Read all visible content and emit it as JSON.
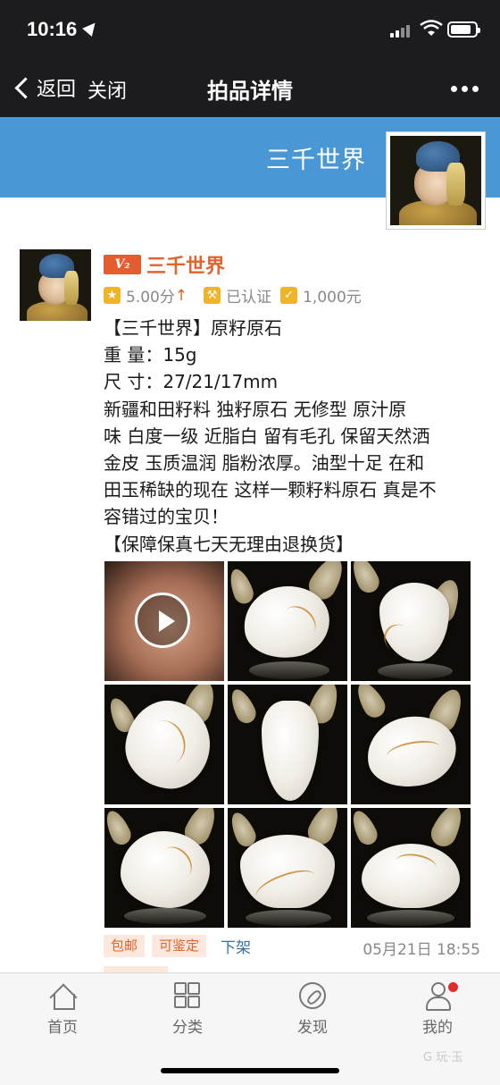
{
  "status_bar": {
    "time": "10:16"
  },
  "nav": {
    "back_label": "返回",
    "close_label": "关闭",
    "title": "拍品详情"
  },
  "banner": {
    "title": "三千世界"
  },
  "post": {
    "level_badge": "V₂",
    "author": "三千世界",
    "rating": "5.00分",
    "rating_trend": "↑",
    "certified": "已认证",
    "deposit": "1,000元",
    "lines": [
      "【三千世界】原籽原石",
      "重 量：15g",
      "尺 寸：27/21/17mm",
      "新疆和田籽料 独籽原石 无修型 原汁原",
      "味 白度一级 近脂白 留有毛孔 保留天然洒",
      "金皮 玉质温润 脂粉浓厚。油型十足 在和",
      "田玉稀缺的现在 这样一颗籽料原石 真是不",
      "容错过的宝贝！",
      "【保障保真七天无理由退换货】"
    ],
    "tags": [
      "包邮",
      "可鉴定"
    ],
    "takedown_label": "下架",
    "datetime": "05月21日 18:55"
  },
  "tabbar": {
    "items": [
      {
        "label": "首页",
        "icon": "home-icon"
      },
      {
        "label": "分类",
        "icon": "category-icon"
      },
      {
        "label": "发现",
        "icon": "compass-icon"
      },
      {
        "label": "我的",
        "icon": "user-icon"
      }
    ]
  },
  "watermark": "G 玩·玉"
}
